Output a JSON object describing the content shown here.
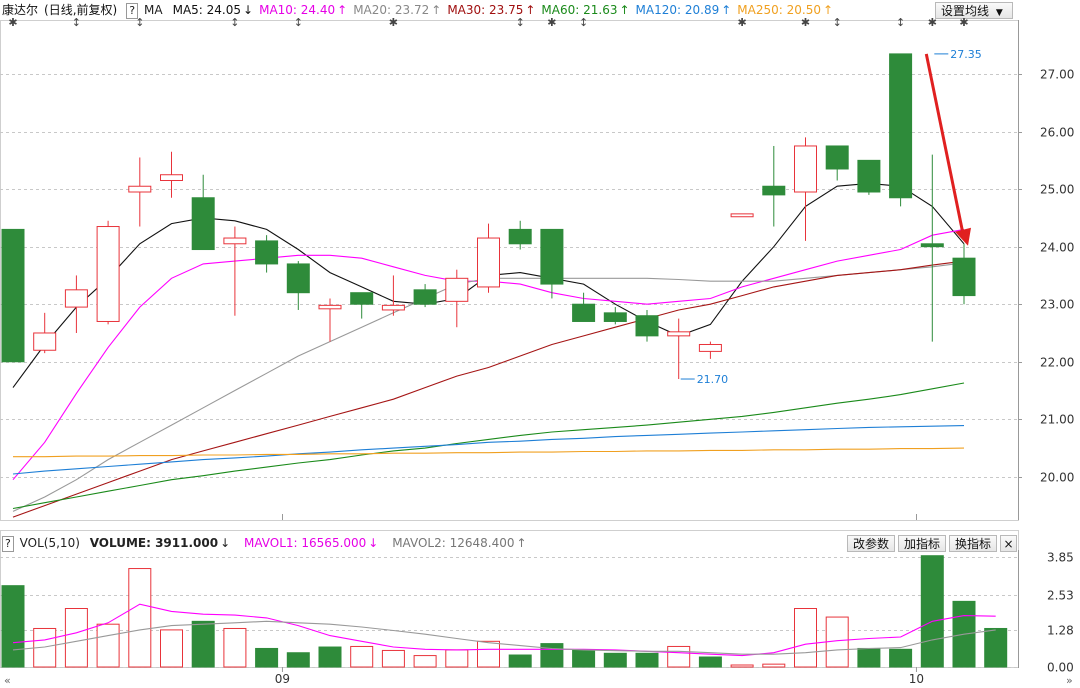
{
  "header": {
    "stock_name": "康达尔",
    "period": "(日线,前复权)",
    "help": "?",
    "indicator": "MA",
    "ma": [
      {
        "label": "MA5: 24.05",
        "arrow": "↓",
        "color": "#111111"
      },
      {
        "label": "MA10: 24.40",
        "arrow": "↑",
        "color": "#e600e6"
      },
      {
        "label": "MA20: 23.72",
        "arrow": "↑",
        "color": "#888888"
      },
      {
        "label": "MA30: 23.75",
        "arrow": "↑",
        "color": "#a01010"
      },
      {
        "label": "MA60: 21.63",
        "arrow": "↑",
        "color": "#1a8a1a"
      },
      {
        "label": "MA120: 20.89",
        "arrow": "↑",
        "color": "#1e7fd6"
      },
      {
        "label": "MA250: 20.50",
        "arrow": "↑",
        "color": "#f0a020"
      }
    ],
    "settings_button": "设置均线"
  },
  "volume_header": {
    "label": "VOL(5,10)",
    "volume": "VOLUME: 3911.000",
    "volume_arrow": "↓",
    "mavol1": "MAVOL1: 16565.000",
    "mavol1_arrow": "↓",
    "mavol2": "MAVOL2: 12648.400",
    "mavol2_arrow": "↑",
    "buttons": [
      "改参数",
      "加指标",
      "换指标"
    ],
    "close": "×"
  },
  "colors": {
    "up": "#e8333a",
    "down": "#2e8b3a",
    "grid": "#c8c8c8",
    "axis_text": "#333333",
    "arrow": "#e02020",
    "annot": "#1e7fd6"
  },
  "chart_data": [
    {
      "type": "candlestick",
      "title": "",
      "y_ticks": [
        "27.00",
        "26.00",
        "25.00",
        "24.00",
        "23.00",
        "22.00",
        "21.00",
        "20.00"
      ],
      "ylim": [
        19.25,
        27.8
      ],
      "x_tick_labels": [
        {
          "label": "09",
          "index": 8.5
        },
        {
          "label": "10",
          "index": 28.5
        }
      ],
      "annotations": [
        {
          "text": "27.35",
          "index": 29,
          "price": 27.35
        },
        {
          "text": "21.70",
          "index": 21,
          "price": 21.7
        }
      ],
      "event_marks": [
        {
          "index": 0,
          "symbol": "✱"
        },
        {
          "index": 2,
          "symbol": "↕"
        },
        {
          "index": 4,
          "symbol": "↕"
        },
        {
          "index": 7,
          "symbol": "↕"
        },
        {
          "index": 9,
          "symbol": "↕"
        },
        {
          "index": 12,
          "symbol": "✱"
        },
        {
          "index": 16,
          "symbol": "↕"
        },
        {
          "index": 17,
          "symbol": "✱"
        },
        {
          "index": 18,
          "symbol": "↕"
        },
        {
          "index": 23,
          "symbol": "✱"
        },
        {
          "index": 25,
          "symbol": "✱"
        },
        {
          "index": 26,
          "symbol": "↕"
        },
        {
          "index": 28,
          "symbol": "↕"
        },
        {
          "index": 29,
          "symbol": "✱"
        },
        {
          "index": 30,
          "symbol": "✱"
        }
      ],
      "candles": [
        {
          "o": 24.3,
          "c": 22.0,
          "h": 24.3,
          "l": 22.0,
          "d": "down"
        },
        {
          "o": 22.2,
          "c": 22.5,
          "h": 22.85,
          "l": 22.15,
          "d": "up"
        },
        {
          "o": 22.95,
          "c": 23.25,
          "h": 23.5,
          "l": 22.5,
          "d": "up"
        },
        {
          "o": 22.7,
          "c": 24.35,
          "h": 24.45,
          "l": 22.65,
          "d": "up"
        },
        {
          "o": 24.95,
          "c": 25.05,
          "h": 25.55,
          "l": 24.35,
          "d": "up"
        },
        {
          "o": 25.15,
          "c": 25.25,
          "h": 25.65,
          "l": 24.85,
          "d": "up"
        },
        {
          "o": 24.85,
          "c": 23.95,
          "h": 25.25,
          "l": 23.95,
          "d": "down"
        },
        {
          "o": 24.05,
          "c": 24.15,
          "h": 24.35,
          "l": 22.8,
          "d": "up"
        },
        {
          "o": 24.1,
          "c": 23.7,
          "h": 24.2,
          "l": 23.55,
          "d": "down"
        },
        {
          "o": 23.7,
          "c": 23.2,
          "h": 23.75,
          "l": 22.9,
          "d": "down"
        },
        {
          "o": 22.92,
          "c": 22.98,
          "h": 23.1,
          "l": 22.35,
          "d": "up"
        },
        {
          "o": 23.2,
          "c": 23.0,
          "h": 23.2,
          "l": 22.75,
          "d": "down"
        },
        {
          "o": 22.9,
          "c": 22.98,
          "h": 23.5,
          "l": 22.8,
          "d": "up"
        },
        {
          "o": 23.25,
          "c": 23.0,
          "h": 23.35,
          "l": 22.95,
          "d": "down"
        },
        {
          "o": 23.05,
          "c": 23.45,
          "h": 23.6,
          "l": 22.6,
          "d": "up"
        },
        {
          "o": 23.3,
          "c": 24.15,
          "h": 24.4,
          "l": 23.2,
          "d": "up"
        },
        {
          "o": 24.3,
          "c": 24.05,
          "h": 24.45,
          "l": 23.95,
          "d": "down"
        },
        {
          "o": 24.3,
          "c": 23.35,
          "h": 24.3,
          "l": 23.1,
          "d": "down"
        },
        {
          "o": 23.0,
          "c": 22.7,
          "h": 23.2,
          "l": 22.7,
          "d": "down"
        },
        {
          "o": 22.85,
          "c": 22.7,
          "h": 22.95,
          "l": 22.65,
          "d": "down"
        },
        {
          "o": 22.8,
          "c": 22.45,
          "h": 22.9,
          "l": 22.35,
          "d": "down"
        },
        {
          "o": 22.45,
          "c": 22.52,
          "h": 22.75,
          "l": 21.7,
          "d": "up"
        },
        {
          "o": 22.18,
          "c": 22.3,
          "h": 22.35,
          "l": 22.05,
          "d": "up"
        },
        {
          "o": 24.52,
          "c": 24.57,
          "h": 24.57,
          "l": 24.52,
          "d": "up"
        },
        {
          "o": 25.05,
          "c": 24.9,
          "h": 25.75,
          "l": 24.35,
          "d": "down"
        },
        {
          "o": 24.95,
          "c": 25.75,
          "h": 25.9,
          "l": 24.1,
          "d": "up"
        },
        {
          "o": 25.75,
          "c": 25.35,
          "h": 25.75,
          "l": 25.15,
          "d": "down"
        },
        {
          "o": 25.5,
          "c": 24.95,
          "h": 25.5,
          "l": 24.9,
          "d": "down"
        },
        {
          "o": 27.35,
          "c": 24.85,
          "h": 27.35,
          "l": 24.7,
          "d": "down"
        },
        {
          "o": 24.05,
          "c": 24.0,
          "h": 25.6,
          "l": 22.35,
          "d": "down"
        },
        {
          "o": 23.8,
          "c": 23.15,
          "h": 24.05,
          "l": 23.0,
          "d": "down"
        }
      ],
      "series": [
        {
          "name": "MA5",
          "color": "#111111",
          "values": [
            21.55,
            22.3,
            22.95,
            23.45,
            24.05,
            24.4,
            24.5,
            24.45,
            24.3,
            23.95,
            23.55,
            23.3,
            23.05,
            23.0,
            23.1,
            23.5,
            23.55,
            23.45,
            23.35,
            23.0,
            22.7,
            22.45,
            22.65,
            23.4,
            24.0,
            24.7,
            25.05,
            25.1,
            25.05,
            24.7,
            24.05
          ]
        },
        {
          "name": "MA10",
          "color": "#ff00ff",
          "values": [
            19.95,
            20.6,
            21.45,
            22.25,
            22.95,
            23.45,
            23.7,
            23.75,
            23.8,
            23.85,
            23.85,
            23.8,
            23.65,
            23.5,
            23.4,
            23.4,
            23.35,
            23.2,
            23.1,
            23.05,
            23.0,
            23.05,
            23.1,
            23.3,
            23.45,
            23.6,
            23.75,
            23.85,
            23.95,
            24.2,
            24.3
          ]
        },
        {
          "name": "MA20",
          "color": "#999999",
          "values": [
            19.4,
            19.65,
            19.95,
            20.3,
            20.6,
            20.9,
            21.2,
            21.5,
            21.8,
            22.1,
            22.35,
            22.6,
            22.85,
            23.1,
            23.35,
            23.45,
            23.45,
            23.45,
            23.45,
            23.45,
            23.45,
            23.43,
            23.4,
            23.4,
            23.4,
            23.45,
            23.5,
            23.55,
            23.6,
            23.65,
            23.72
          ]
        },
        {
          "name": "MA30",
          "color": "#a51515",
          "values": [
            19.3,
            19.5,
            19.7,
            19.9,
            20.1,
            20.3,
            20.45,
            20.6,
            20.75,
            20.9,
            21.05,
            21.2,
            21.35,
            21.55,
            21.75,
            21.9,
            22.1,
            22.3,
            22.45,
            22.6,
            22.75,
            22.9,
            23.0,
            23.15,
            23.3,
            23.4,
            23.5,
            23.55,
            23.6,
            23.68,
            23.75
          ]
        },
        {
          "name": "MA60",
          "color": "#1a8a1a",
          "values": [
            19.45,
            19.55,
            19.65,
            19.75,
            19.85,
            19.95,
            20.02,
            20.1,
            20.17,
            20.24,
            20.3,
            20.38,
            20.45,
            20.5,
            20.58,
            20.65,
            20.72,
            20.78,
            20.82,
            20.86,
            20.9,
            20.95,
            21.0,
            21.05,
            21.12,
            21.2,
            21.28,
            21.35,
            21.43,
            21.53,
            21.63
          ]
        },
        {
          "name": "MA120",
          "color": "#1e7fd6",
          "values": [
            20.05,
            20.1,
            20.14,
            20.18,
            20.22,
            20.26,
            20.3,
            20.33,
            20.36,
            20.4,
            20.43,
            20.47,
            20.5,
            20.53,
            20.56,
            20.6,
            20.62,
            20.65,
            20.67,
            20.7,
            20.72,
            20.74,
            20.76,
            20.78,
            20.8,
            20.82,
            20.84,
            20.86,
            20.87,
            20.88,
            20.89
          ]
        },
        {
          "name": "MA250",
          "color": "#f0a020",
          "values": [
            20.35,
            20.35,
            20.36,
            20.36,
            20.37,
            20.37,
            20.38,
            20.38,
            20.39,
            20.39,
            20.4,
            20.4,
            20.41,
            20.41,
            20.42,
            20.42,
            20.43,
            20.43,
            20.44,
            20.44,
            20.45,
            20.45,
            20.46,
            20.46,
            20.47,
            20.47,
            20.48,
            20.48,
            20.49,
            20.49,
            20.5
          ]
        }
      ]
    },
    {
      "type": "bar",
      "title": "",
      "y_ticks": [
        "3.85",
        "2.53",
        "1.28",
        "0.00"
      ],
      "ylim": [
        0,
        4.1
      ],
      "values": [
        2.85,
        1.35,
        2.05,
        1.5,
        3.45,
        1.3,
        1.6,
        1.35,
        0.65,
        0.5,
        0.7,
        0.72,
        0.58,
        0.4,
        0.6,
        0.9,
        0.42,
        0.82,
        0.6,
        0.48,
        0.48,
        0.72,
        0.35,
        0.07,
        0.1,
        2.05,
        1.75,
        0.65,
        0.62,
        3.9,
        2.3,
        1.35
      ],
      "directions": [
        "down",
        "up",
        "up",
        "up",
        "up",
        "up",
        "down",
        "up",
        "down",
        "down",
        "down",
        "up",
        "up",
        "up",
        "up",
        "up",
        "down",
        "down",
        "down",
        "down",
        "down",
        "up",
        "down",
        "up",
        "up",
        "up",
        "up",
        "down",
        "down",
        "down",
        "down",
        "down"
      ],
      "series": [
        {
          "name": "MAVOL1",
          "color": "#ff00ff",
          "values": [
            0.85,
            0.95,
            1.2,
            1.55,
            2.2,
            1.95,
            1.85,
            1.82,
            1.72,
            1.45,
            1.1,
            0.9,
            0.7,
            0.62,
            0.6,
            0.62,
            0.62,
            0.62,
            0.62,
            0.6,
            0.55,
            0.5,
            0.45,
            0.4,
            0.5,
            0.8,
            0.92,
            1.0,
            1.05,
            1.6,
            1.8,
            1.78
          ]
        },
        {
          "name": "MAVOL2",
          "color": "#999999",
          "values": [
            0.6,
            0.7,
            0.9,
            1.1,
            1.3,
            1.45,
            1.5,
            1.55,
            1.6,
            1.55,
            1.5,
            1.4,
            1.28,
            1.15,
            1.0,
            0.85,
            0.75,
            0.65,
            0.6,
            0.57,
            0.55,
            0.55,
            0.5,
            0.45,
            0.45,
            0.5,
            0.6,
            0.65,
            0.68,
            0.95,
            1.15,
            1.3
          ]
        }
      ]
    }
  ]
}
